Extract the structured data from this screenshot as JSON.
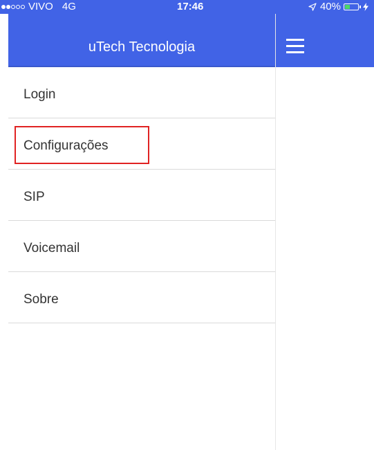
{
  "status_bar": {
    "carrier": "VIVO",
    "network": "4G",
    "time": "17:46",
    "battery_percent": "40%",
    "signal_bars_filled": 2,
    "signal_bars_total": 5,
    "battery_level": 0.4,
    "background_color": "#4163e6",
    "battery_fill_color": "#4cd964"
  },
  "drawer": {
    "title": "uTech Tecnologia",
    "header_color": "#4163e6",
    "items": [
      {
        "label": "Login"
      },
      {
        "label": "Configurações",
        "highlighted": true
      },
      {
        "label": "SIP"
      },
      {
        "label": "Voicemail"
      },
      {
        "label": "Sobre"
      }
    ],
    "highlight_color": "#e02222"
  },
  "main": {
    "menu_icon": "hamburger-menu-icon"
  }
}
